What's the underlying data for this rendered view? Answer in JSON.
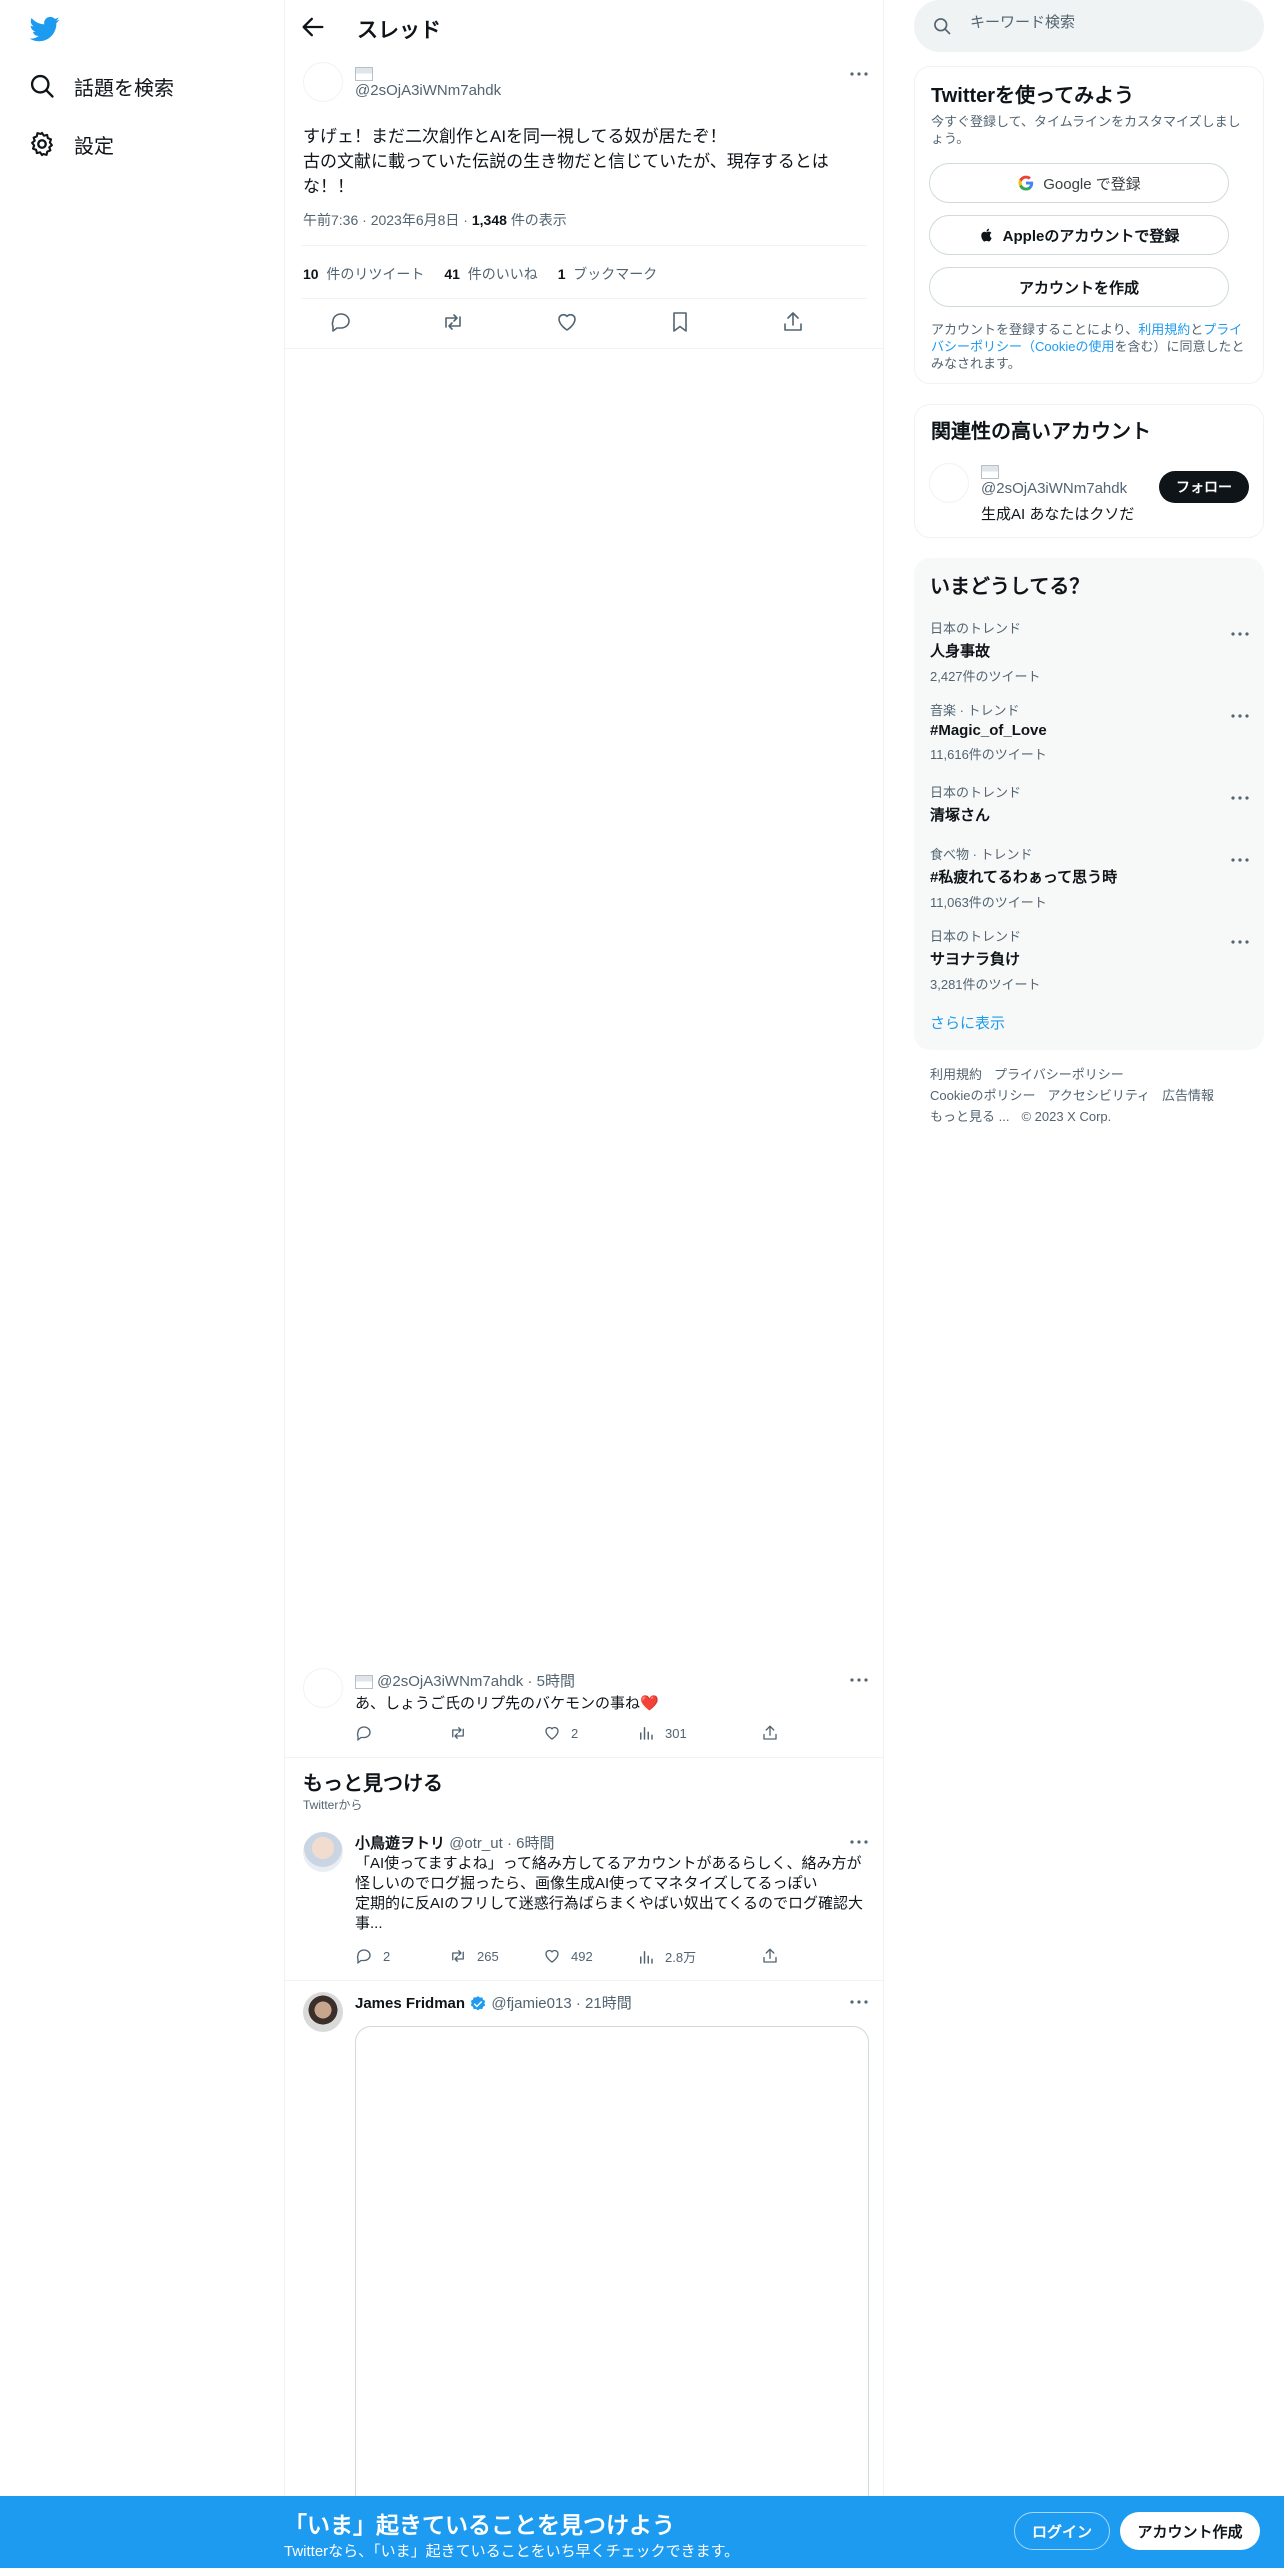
{
  "colors": {
    "brand": "#1d9bf0",
    "text": "#0f1419",
    "muted": "#536471",
    "border": "#eff3f4",
    "verified": "#1d9bf0"
  },
  "nav": {
    "logo": "twitter-bird-icon",
    "items": [
      {
        "label": "話題を検索",
        "icon": "search-icon"
      },
      {
        "label": "設定",
        "icon": "gear-icon"
      }
    ]
  },
  "header": {
    "title": "スレッド"
  },
  "main_tweet": {
    "handle": "@2sOjA3iWNm7ahdk",
    "text": "すげェ！まだ二次創作とAIを同一視してる奴が居たぞ！\n古の文献に載っていた伝説の生き物だと信じていたが、現存するとはな！！",
    "time": "午前7:36",
    "date": "2023年6月8日",
    "views_count": "1,348",
    "views_label": "件の表示",
    "retweets_count": "10",
    "retweets_label": "件のリツイート",
    "likes_count": "41",
    "likes_label": "件のいいね",
    "bookmarks_count": "1",
    "bookmarks_label": "ブックマーク"
  },
  "reply_tweet": {
    "handle": "@2sOjA3iWNm7ahdk",
    "age": "5時間",
    "text": "あ、しょうご氏のリプ先のバケモンの事ね",
    "emoji": "❤️",
    "replies": "",
    "retweets": "",
    "likes": "2",
    "views": "301"
  },
  "more": {
    "title": "もっと見つける",
    "subtitle": "Twitterから"
  },
  "rec_tweets": [
    {
      "name": "小鳥遊ヲトリ",
      "handle": "@otr_ut",
      "age": "6時間",
      "lines": [
        "「AI使ってますよね」って絡み方してるアカウントがあるらしく、絡み方が",
        "怪しいのでログ掘ったら、画像生成AI使ってマネタイズしてるっぽい",
        "定期的に反AIのフリして迷惑行為ばらまくやばい奴出てくるのでログ確認大",
        "事..."
      ],
      "replies": "2",
      "retweets": "265",
      "likes": "492",
      "views": "2.8万"
    },
    {
      "name": "James Fridman",
      "handle": "@fjamie013",
      "age": "21時間"
    }
  ],
  "search": {
    "placeholder": "キーワード検索"
  },
  "signup_card": {
    "title": "Twitterを使ってみよう",
    "subtitle": "今すぐ登録して、タイムラインをカスタマイズしましょう。",
    "google_label": "Google で登録",
    "apple_label": "Appleのアカウントで登録",
    "create_label": "アカウントを作成",
    "legal_prefix": "アカウントを登録することにより、",
    "legal_terms": "利用規約",
    "legal_and": "と",
    "legal_privacy": "プライバシーポリシー（Cookieの使用",
    "legal_suffix": "を含む）に同意したとみなされます。"
  },
  "related": {
    "title": "関連性の高いアカウント",
    "handle": "@2sOjA3iWNm7ahdk",
    "bio": "生成AI あなたはクソだ",
    "follow_label": "フォロー"
  },
  "trends": {
    "title": "いまどうしてる？",
    "items": [
      {
        "context": "日本のトレンド",
        "name": "人身事故",
        "count": "2,427件のツイート"
      },
      {
        "context": "音楽 · トレンド",
        "name": "#Magic_of_Love",
        "count": "11,616件のツイート"
      },
      {
        "context": "日本のトレンド",
        "name": "清塚さん",
        "count": ""
      },
      {
        "context": "食べ物 · トレンド",
        "name": "#私疲れてるわぁって思う時",
        "count": "11,063件のツイート"
      },
      {
        "context": "日本のトレンド",
        "name": "サヨナラ負け",
        "count": "3,281件のツイート"
      }
    ],
    "show_more": "さらに表示"
  },
  "footer": {
    "row1": [
      "利用規約",
      "プライバシーポリシー"
    ],
    "row2": [
      "Cookieのポリシー",
      "アクセシビリティ",
      "広告情報"
    ],
    "row3": [
      "もっと見る ...",
      "© 2023 X Corp."
    ]
  },
  "banner": {
    "title": "「いま」起きていることを見つけよう",
    "subtitle": "Twitterなら、「いま」起きていることをいち早くチェックできます。",
    "login_label": "ログイン",
    "signup_label": "アカウント作成"
  }
}
